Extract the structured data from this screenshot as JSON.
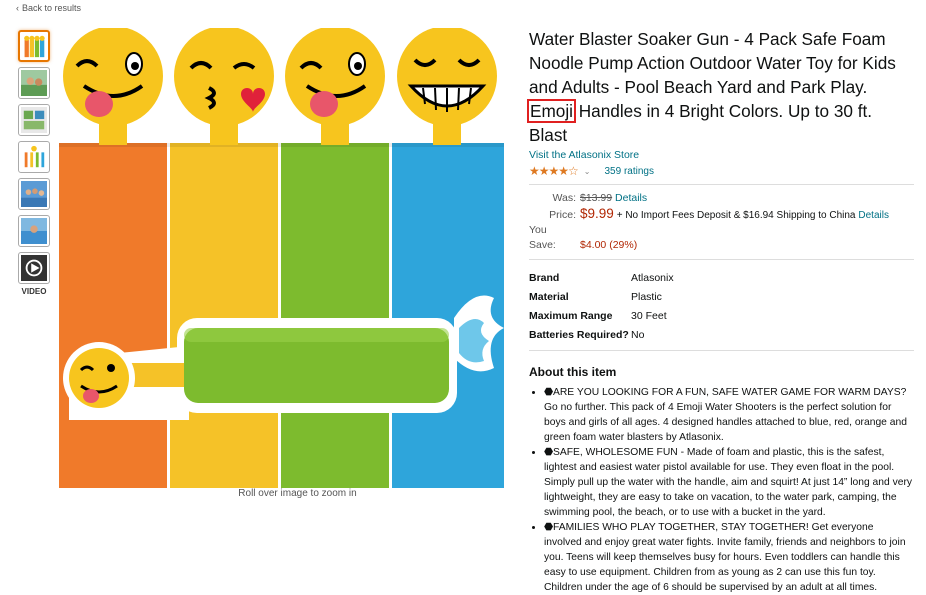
{
  "nav": {
    "back_label": "Back to results"
  },
  "gallery": {
    "video_label": "VIDEO",
    "zoom_hint": "Roll over image to zoom in"
  },
  "product": {
    "title_before": "Water Blaster Soaker Gun - 4 Pack Safe Foam Noodle Pump Action Outdoor Water Toy for Kids and Adults - Pool Beach Yard and Park Play.",
    "title_highlight": "Emoji",
    "title_after": "Handles in 4 Bright Colors. Up to 30 ft. Blast",
    "store_link": "Visit the Atlasonix Store",
    "stars": "★★★★☆",
    "rating_count": "359 ratings"
  },
  "pricing": {
    "was_label": "Was:",
    "was_value": "$13.99",
    "details_link": "Details",
    "price_label": "Price:",
    "price_value": "$9.99",
    "shipping_text": "+ No Import Fees Deposit & $16.94 Shipping to China",
    "shipping_details_link": "Details",
    "save_label": "You Save:",
    "save_value": "$4.00 (29%)"
  },
  "specs": [
    {
      "key": "Brand",
      "value": "Atlasonix"
    },
    {
      "key": "Material",
      "value": "Plastic"
    },
    {
      "key": "Maximum Range",
      "value": "30 Feet"
    },
    {
      "key": "Batteries Required?",
      "value": "No"
    }
  ],
  "about": {
    "heading": "About this item",
    "bullets": [
      "⬣ARE YOU LOOKING FOR A FUN, SAFE WATER GAME FOR WARM DAYS? Go no further. This pack of 4 Emoji Water Shooters is the perfect solution for boys and girls of all ages. 4 designed handles attached to blue, red, orange and green foam water blasters by Atlasonix.",
      "⬣SAFE, WHOLESOME FUN - Made of foam and plastic, this is the safest, lightest and easiest water pistol available for use. They even float in the pool. Simply pull up the water with the handle, aim and squirt! At just 14” long and very lightweight, they are easy to take on vacation, to the water park, camping, the swimming pool, the beach, or to use with a bucket in the yard.",
      "⬣FAMILIES WHO PLAY TOGETHER, STAY TOGETHER! Get everyone involved and enjoy great water fights. Invite family, friends and neighbors to join you. Teens will keep themselves busy for hours. Even toddlers can handle this easy to use equipment. Children from as young as 2 can use this fun toy. Children under the age of 6 should be supervised by an adult at all times."
    ]
  },
  "colors": {
    "orange": "#F07A2A",
    "yellow": "#F5C228",
    "green": "#7DBB2E",
    "blue": "#2EA5DB",
    "emoji": "#F7C51E",
    "price_red": "#B12704",
    "link": "#007185",
    "highlight": "#E02020"
  }
}
